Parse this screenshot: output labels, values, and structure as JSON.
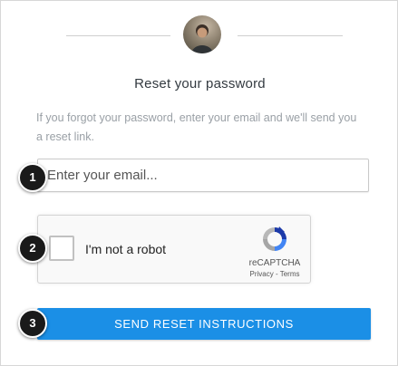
{
  "page": {
    "title": "Reset your password",
    "description": "If you forgot your password, enter your email and we'll send you a reset link."
  },
  "email_field": {
    "placeholder": "Enter your email..."
  },
  "captcha": {
    "label": "I'm not a robot",
    "brand": "reCAPTCHA",
    "links": "Privacy - Terms"
  },
  "submit": {
    "label": "SEND RESET INSTRUCTIONS"
  },
  "steps": [
    "1",
    "2",
    "3"
  ],
  "colors": {
    "button": "#1b8fe6",
    "step_badge": "#1a1a1a"
  }
}
